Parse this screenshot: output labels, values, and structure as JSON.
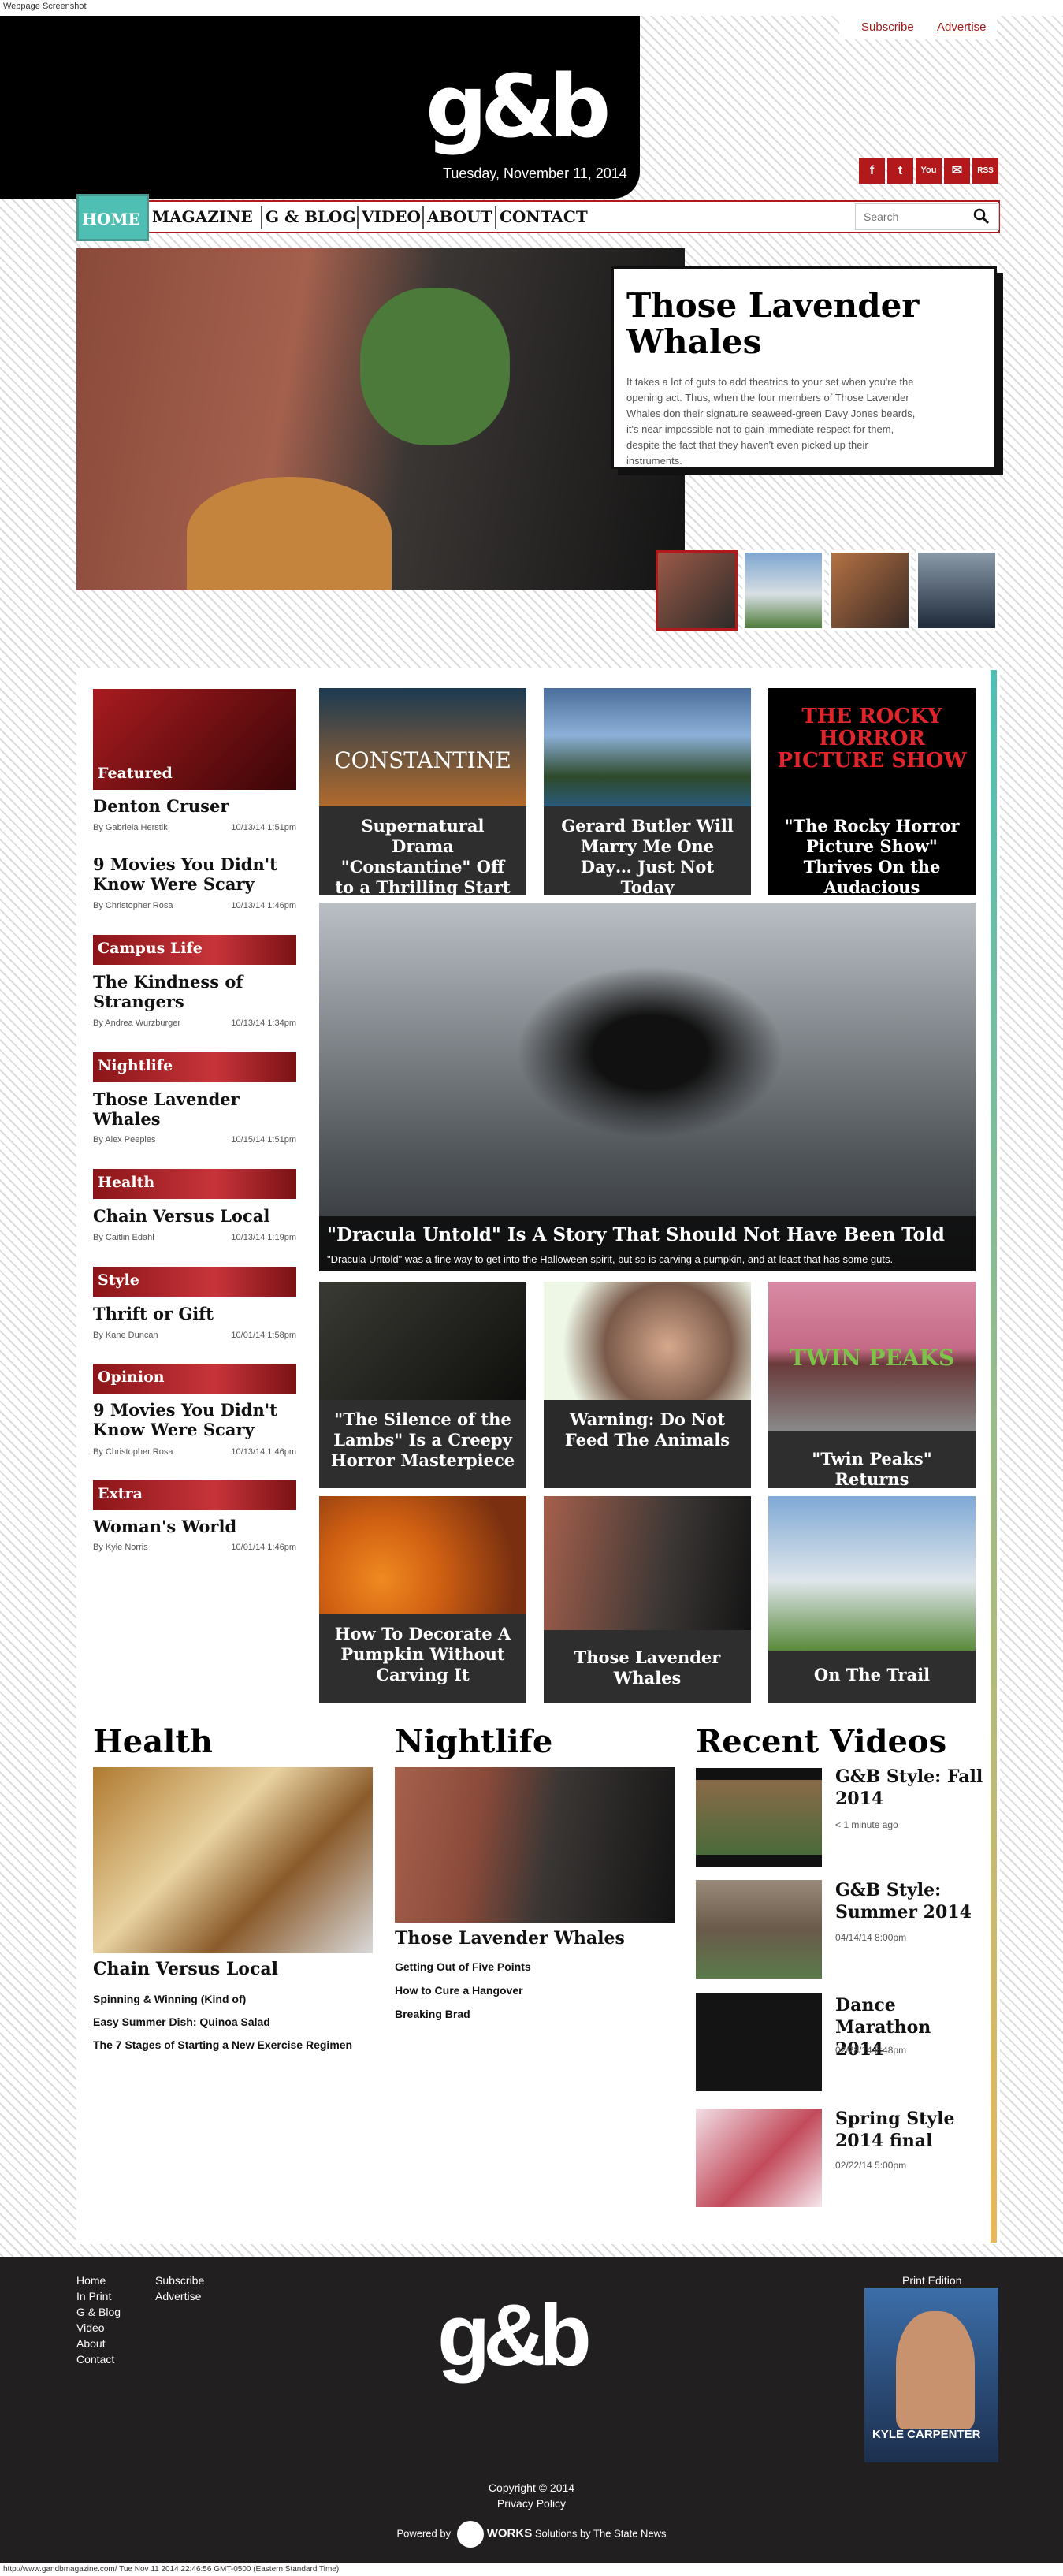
{
  "browser": {
    "top_label": "Webpage Screenshot",
    "bottom_label": "http://www.gandbmagazine.com/ Tue Nov 11 2014 22:46:56 GMT-0500 (Eastern Standard Time)"
  },
  "topbar": {
    "subscribe": "Subscribe",
    "advertise": "Advertise"
  },
  "header": {
    "logo": "g&b",
    "date": "Tuesday, November 11, 2014"
  },
  "social": [
    "f",
    "t",
    "You",
    "✉",
    "RSS"
  ],
  "nav": {
    "items": [
      "HOME",
      "MAGAZINE",
      "G & BLOG",
      "VIDEO",
      "ABOUT",
      "CONTACT"
    ],
    "search_placeholder": "Search"
  },
  "hero": {
    "title": "Those Lavender Whales",
    "excerpt": "It takes a lot of guts to add theatrics to your set when you're the opening act. Thus, when the four members of Those Lavender Whales don their signature seaweed-green Davy Jones beards, it's near impossible not to gain immediate respect for them, despite the fact that they haven't even picked up their instruments."
  },
  "sidebar": [
    {
      "section": "Featured",
      "title": "Denton Cruser",
      "author": "By Gabriela Herstik",
      "date": "10/13/14 1:51pm"
    },
    {
      "section": "",
      "title": "9 Movies You Didn't Know Were Scary",
      "author": "By Christopher Rosa",
      "date": "10/13/14 1:46pm"
    },
    {
      "section": "Campus Life",
      "title": "The Kindness of Strangers",
      "author": "By Andrea Wurzburger",
      "date": "10/13/14 1:34pm"
    },
    {
      "section": "Nightlife",
      "title": "Those Lavender Whales",
      "author": "By Alex Peeples",
      "date": "10/15/14 1:51pm"
    },
    {
      "section": "Health",
      "title": "Chain Versus Local",
      "author": "By Caitlin Edahl",
      "date": "10/13/14 1:19pm"
    },
    {
      "section": "Style",
      "title": "Thrift or Gift",
      "author": "By Kane Duncan",
      "date": "10/01/14 1:58pm"
    },
    {
      "section": "Opinion",
      "title": "9 Movies You Didn't Know Were Scary",
      "author": "By Christopher Rosa",
      "date": "10/13/14 1:46pm"
    },
    {
      "section": "Extra",
      "title": "Woman's World",
      "author": "By Kyle Norris",
      "date": "10/01/14 1:46pm"
    }
  ],
  "tiles": [
    {
      "caption": "Supernatural Drama \"Constantine\" Off to a Thrilling Start",
      "overlay": "CONSTANTINE"
    },
    {
      "caption": "Gerard Butler Will Marry Me One Day… Just Not Today",
      "overlay": ""
    },
    {
      "caption": "\"The Rocky Horror Picture Show\" Thrives On the Audacious",
      "overlay": "THE ROCKY HORROR PICTURE SHOW"
    },
    {
      "caption": "\"The Silence of the Lambs\" Is a Creepy Horror Masterpiece",
      "overlay": ""
    },
    {
      "caption": "Warning: Do Not Feed The Animals",
      "overlay": ""
    },
    {
      "caption": "\"Twin Peaks\" Returns",
      "overlay": "TWIN PEAKS"
    },
    {
      "caption": "How To Decorate A Pumpkin Without Carving It",
      "overlay": ""
    },
    {
      "caption": "Those Lavender Whales",
      "overlay": ""
    },
    {
      "caption": "On The Trail",
      "overlay": ""
    }
  ],
  "big_story": {
    "title": "\"Dracula Untold\" Is A Story That Should Not Have Been Told",
    "excerpt": "\"Dracula Untold\" was a fine way to get into the Halloween spirit, but so is carving a pumpkin, and at least that has some guts."
  },
  "health": {
    "heading": "Health",
    "lead": "Chain Versus Local",
    "links": [
      "Spinning & Winning (Kind of)",
      "Easy Summer Dish: Quinoa Salad",
      "The 7 Stages of Starting a New Exercise Regimen"
    ]
  },
  "nightlife": {
    "heading": "Nightlife",
    "lead": "Those Lavender Whales",
    "links": [
      "Getting Out of Five Points",
      "How to Cure a Hangover",
      "Breaking Brad"
    ]
  },
  "videos": {
    "heading": "Recent Videos",
    "items": [
      {
        "title": "G&B Style: Fall 2014",
        "date": "< 1 minute ago"
      },
      {
        "title": "G&B Style: Summer 2014",
        "date": "04/14/14 8:00pm"
      },
      {
        "title": "Dance Marathon 2014",
        "date": "02/28/14 5:48pm"
      },
      {
        "title": "Spring Style 2014 final",
        "date": "02/22/14 5:00pm"
      }
    ]
  },
  "footer": {
    "col1": [
      "Home",
      "In Print",
      "G & Blog",
      "Video",
      "About",
      "Contact"
    ],
    "col2": [
      "Subscribe",
      "Advertise"
    ],
    "logo": "g&b",
    "print_label": "Print Edition",
    "cover_name": "KYLE CARPENTER",
    "copyright": "Copyright © 2014",
    "privacy": "Privacy Policy",
    "powered_pre": "Powered by",
    "powered_brand": "WORKS",
    "powered_post": "Solutions by The State News"
  }
}
